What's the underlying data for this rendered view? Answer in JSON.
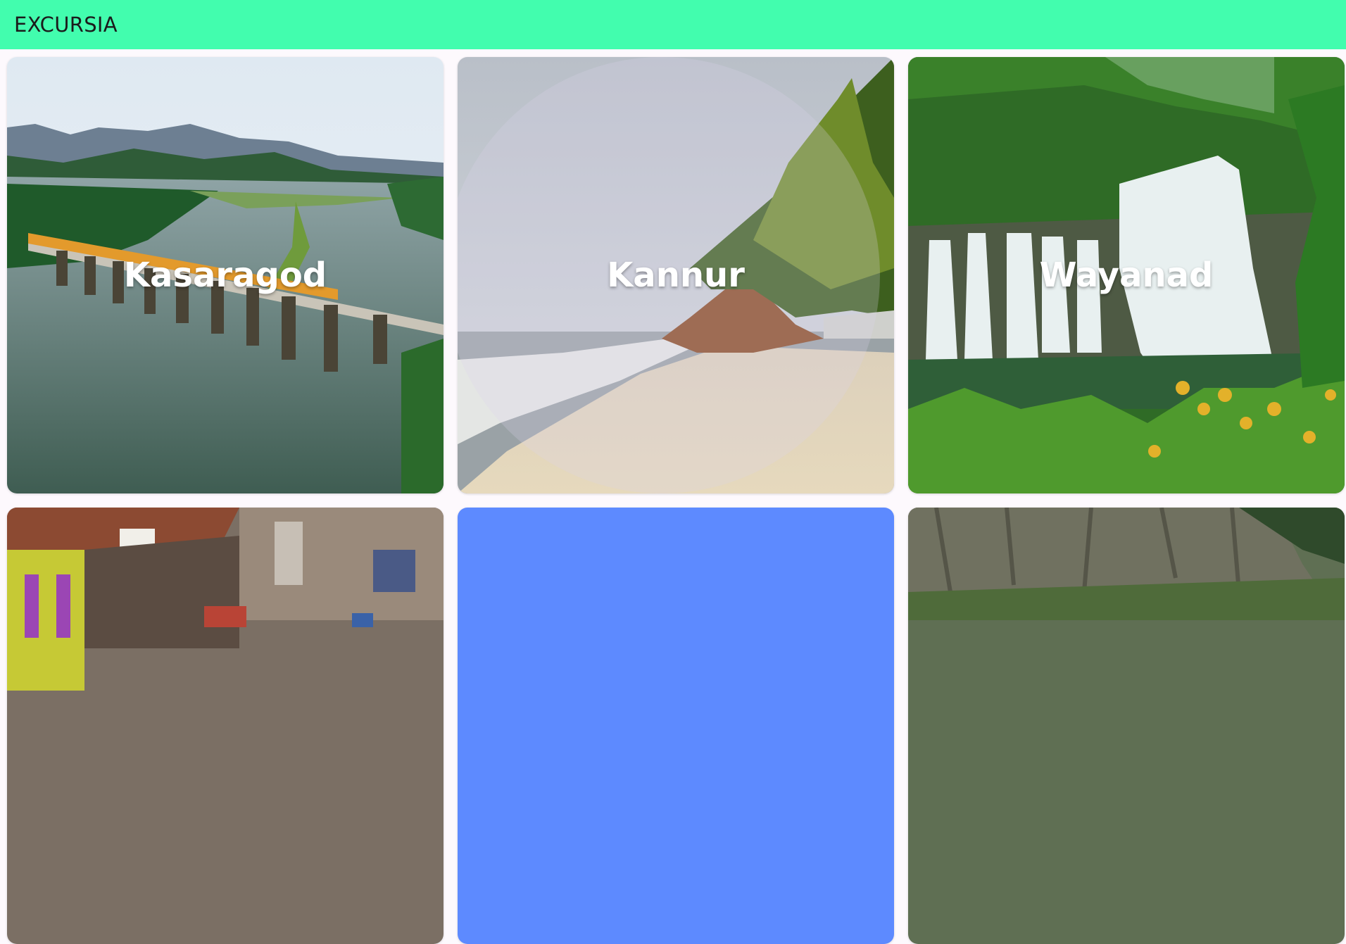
{
  "appbar": {
    "title": "EXCURSIA",
    "color": "#42fdae"
  },
  "destinations": [
    {
      "name": "Kasaragod",
      "scene": "river-bridge-train"
    },
    {
      "name": "Kannur",
      "scene": "beach-palms"
    },
    {
      "name": "Wayanad",
      "scene": "waterfall-forest"
    },
    {
      "name": "",
      "scene": "town-street"
    },
    {
      "name": "",
      "scene": "loading-placeholder",
      "color": "#5d8aff"
    },
    {
      "name": "",
      "scene": "cliff-forest"
    }
  ]
}
